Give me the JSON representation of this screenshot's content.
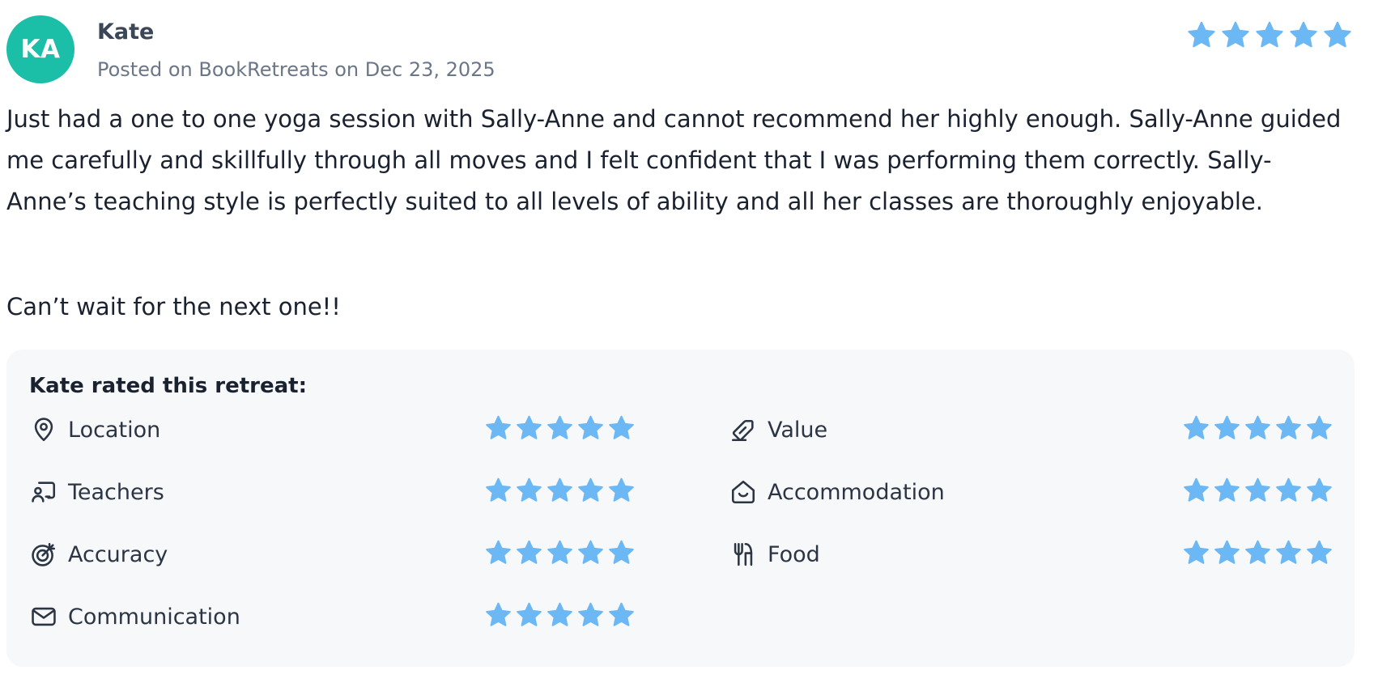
{
  "review": {
    "avatar_initials": "KA",
    "avatar_color": "#1bbea7",
    "name": "Kate",
    "posted": "Posted on BookRetreats on Dec 23, 2025",
    "overall_rating": 5,
    "star_color": "#6cb8f5",
    "paragraph_1": "Just had a one to one yoga session with Sally-Anne and cannot recommend her highly enough. Sally-Anne guided me carefully and skillfully through all moves and I felt confident that I was performing them correctly. Sally-Anne’s teaching style is perfectly suited to all levels of ability and all her classes are thoroughly enjoyable.",
    "paragraph_2": "Can’t wait for the next one!!"
  },
  "ratings": {
    "title": "Kate rated this retreat:",
    "items": [
      {
        "label": "Location",
        "icon": "location-pin-icon",
        "stars": 5
      },
      {
        "label": "Value",
        "icon": "price-tag-icon",
        "stars": 5
      },
      {
        "label": "Teachers",
        "icon": "teacher-icon",
        "stars": 5
      },
      {
        "label": "Accommodation",
        "icon": "house-icon",
        "stars": 5
      },
      {
        "label": "Accuracy",
        "icon": "target-icon",
        "stars": 5
      },
      {
        "label": "Food",
        "icon": "fork-knife-icon",
        "stars": 5
      },
      {
        "label": "Communication",
        "icon": "mail-icon",
        "stars": 5
      }
    ]
  }
}
